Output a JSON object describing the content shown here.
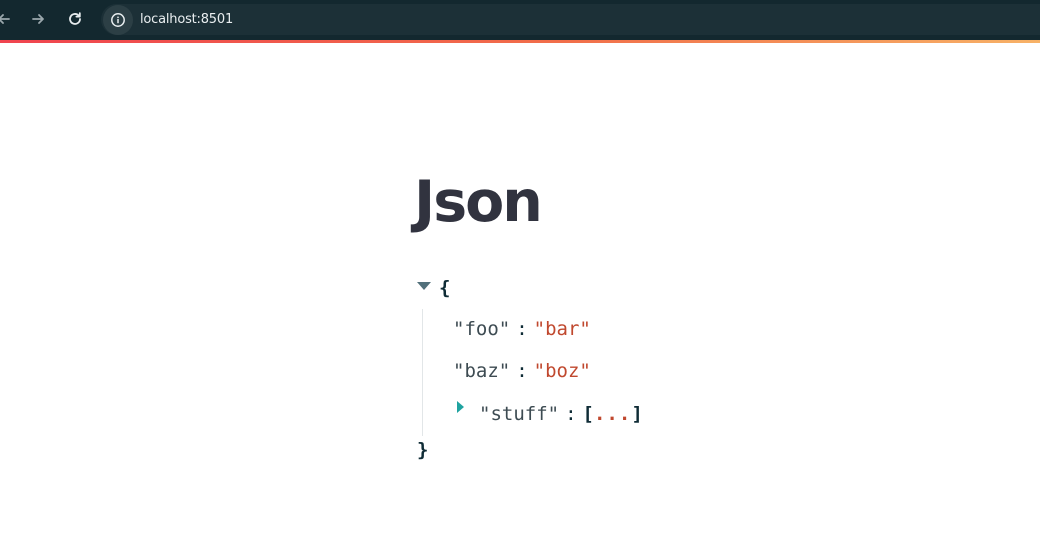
{
  "browser": {
    "url": "localhost:8501",
    "icons": {
      "back": "arrow-left-icon",
      "forward": "arrow-right-icon",
      "reload": "reload-icon",
      "info": "info-circle-icon"
    },
    "accent_colors": [
      "#f0444f",
      "#f16f4a",
      "#f7b267"
    ]
  },
  "page": {
    "title": "Json"
  },
  "json_viewer": {
    "open_brace": "{",
    "close_brace": "}",
    "colon": ":",
    "entries": [
      {
        "key": "\"foo\"",
        "value": "\"bar\""
      },
      {
        "key": "\"baz\"",
        "value": "\"boz\""
      }
    ],
    "collapsed": {
      "key": "\"stuff\"",
      "open_bracket": "[",
      "ellipsis": "...",
      "close_bracket": "]"
    },
    "colors": {
      "key": "#3d4b52",
      "string": "#c0482e",
      "punctuation": "#0f2c36",
      "expand_toggle": "#1fa3a0"
    }
  }
}
